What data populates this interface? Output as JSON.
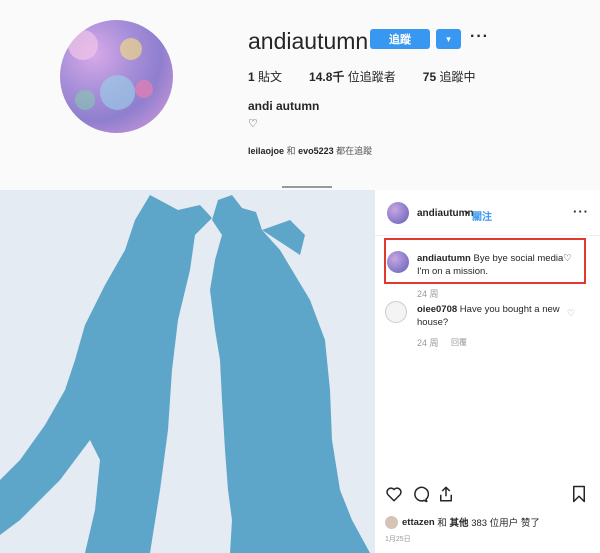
{
  "profile": {
    "username": "andiautumn",
    "follow_label": "追蹤",
    "dropdown_icon": "▾",
    "more_icon": "···",
    "posts_count": "1",
    "posts_label": "貼文",
    "followers_count": "14.8千",
    "followers_label": "位追蹤者",
    "following_count": "75",
    "following_label": "追蹤中",
    "full_name": "andi autumn",
    "bio": "♡",
    "followed_by_user1": "leilaojoe",
    "followed_by_and": "和",
    "followed_by_user2": "evo5223",
    "followed_by_suffix": "都在追蹤"
  },
  "post": {
    "header": {
      "username": "andiautumn",
      "separator": "•",
      "follow_label": "關注",
      "more_icon": "···"
    },
    "caption": {
      "username": "andiautumn",
      "text_line1": "Bye bye social media♡",
      "text_line2": "I'm on a mission.",
      "time": "24 周"
    },
    "comments": [
      {
        "username": "oiee0708",
        "text_line1": "Have you bought a new",
        "text_line2": "house?",
        "time": "24 周",
        "reply_label": "回覆"
      }
    ],
    "actions": {
      "like_icon": "heart-icon",
      "comment_icon": "comment-icon",
      "share_icon": "share-icon",
      "save_icon": "bookmark-icon"
    },
    "likes": {
      "user": "ettazen",
      "and_label": "和",
      "others_label": "其他",
      "count": "383 位用户",
      "suffix": "赞了"
    },
    "date": "1月25日"
  },
  "colors": {
    "accent": "#3897f0",
    "highlight_border": "#e0392f",
    "shadow_blue": "#5ea6c9",
    "photo_bg": "#e5ecf3"
  }
}
